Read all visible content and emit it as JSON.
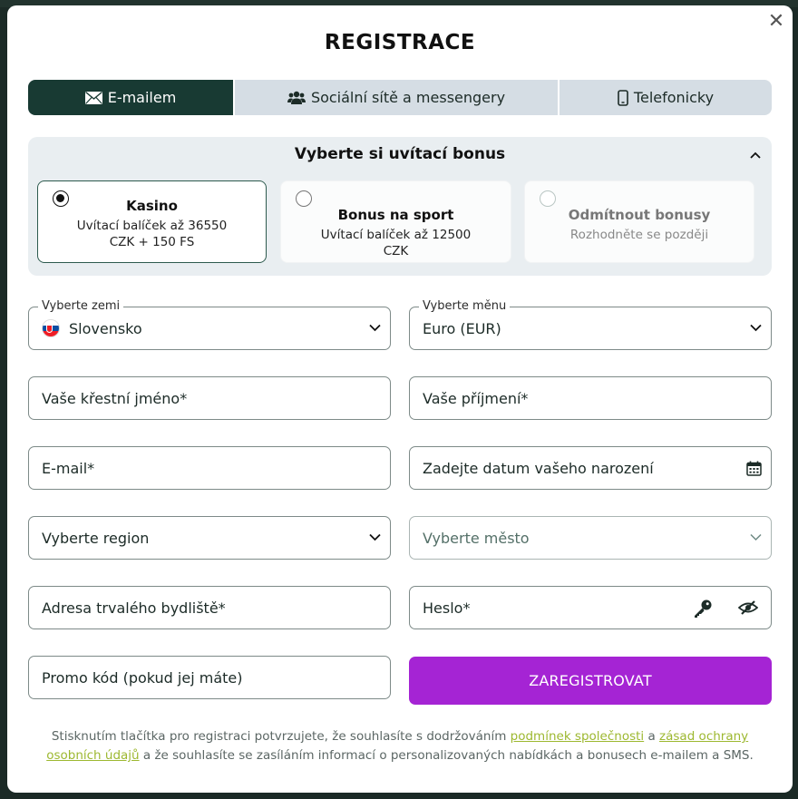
{
  "modal": {
    "close_label": "✕",
    "title": "REGISTRACE"
  },
  "tabs": [
    {
      "label": "E-mailem",
      "icon": "envelope-icon",
      "active": true
    },
    {
      "label": "Sociální sítě a messengery",
      "icon": "users-icon",
      "active": false
    },
    {
      "label": "Telefonicky",
      "icon": "phone-icon",
      "active": false
    }
  ],
  "bonus": {
    "title": "Vyberte si uvítací bonus",
    "options": [
      {
        "name": "Kasino",
        "description": "Uvítací balíček až 36550 CZK + 150 FS",
        "selected": true
      },
      {
        "name": "Bonus na sport",
        "description": "Uvítací balíček až 12500 CZK",
        "selected": false
      },
      {
        "name": "Odmítnout bonusy",
        "description": "Rozhodněte se později",
        "selected": false
      }
    ]
  },
  "form": {
    "country": {
      "label": "Vyberte zemi",
      "value": "Slovensko"
    },
    "currency": {
      "label": "Vyberte měnu",
      "value": "Euro (EUR)"
    },
    "first_name": {
      "placeholder": "Vaše křestní jméno*"
    },
    "last_name": {
      "placeholder": "Vaše příjmení*"
    },
    "email": {
      "placeholder": "E-mail*"
    },
    "birth_date": {
      "placeholder": "Zadejte datum vašeho narození"
    },
    "region": {
      "value": "Vyberte region"
    },
    "city": {
      "value": "Vyberte město"
    },
    "address": {
      "placeholder": "Adresa trvalého bydliště*"
    },
    "password": {
      "placeholder": "Heslo*"
    },
    "promo": {
      "placeholder": "Promo kód (pokud jej máte)"
    },
    "submit_label": "ZAREGISTROVAT"
  },
  "terms": {
    "part1": "Stisknutím tlačítka pro registraci potvrzujete, že souhlasíte s dodržováním ",
    "link1": "podmínek společnosti",
    "part2": " a ",
    "link2": "zásad ochrany osobních údajů",
    "part3": " a že souhlasíte se zasíláním informací o personalizovaných nabídkách a bonusech e-mailem a SMS."
  },
  "colors": {
    "active_tab": "#183a33",
    "submit": "#a524d4",
    "link": "#9db830"
  }
}
